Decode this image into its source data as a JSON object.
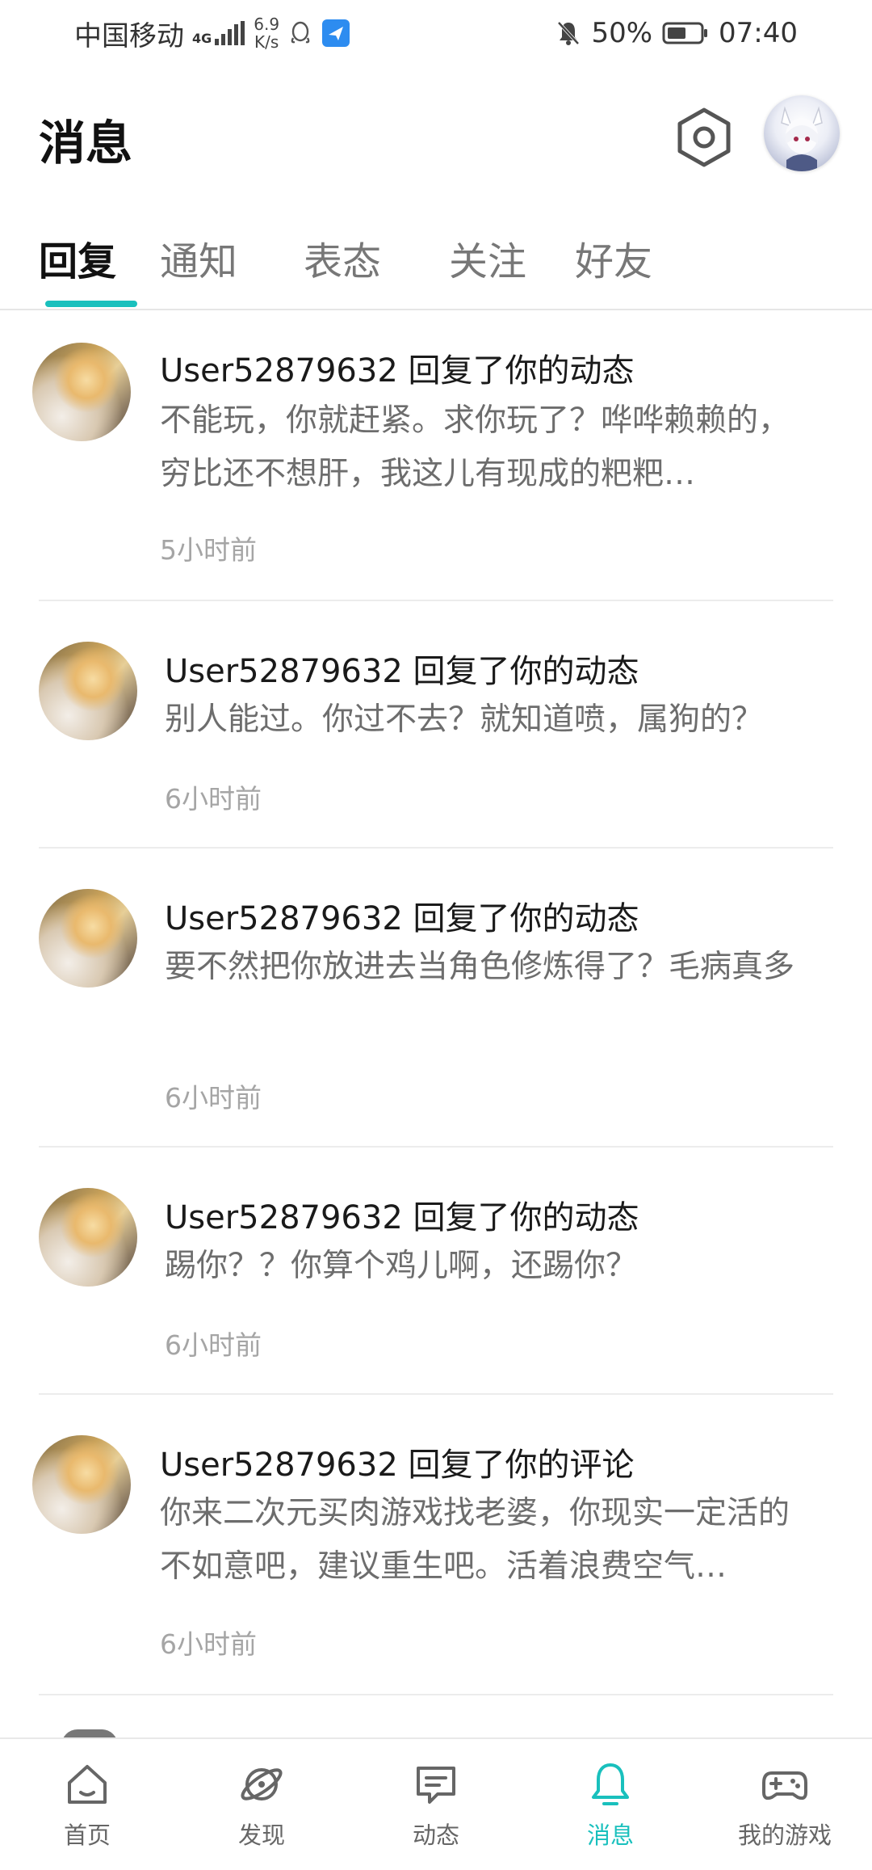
{
  "status_bar": {
    "carrier": "中国移动",
    "network_tag": "4G",
    "net_speed_value": "6.9",
    "net_speed_unit": "K/s",
    "battery": "50%",
    "time": "07:40"
  },
  "header": {
    "title": "消息"
  },
  "tabs": [
    {
      "label": "回复",
      "active": true
    },
    {
      "label": "通知",
      "active": false
    },
    {
      "label": "表态",
      "active": false
    },
    {
      "label": "关注",
      "active": false
    },
    {
      "label": "好友",
      "active": false
    }
  ],
  "messages": [
    {
      "title": "User52879632 回复了你的动态",
      "body": "不能玩，你就赶紧。求你玩了？哗哗赖赖的，穷比还不想肝，我这儿有现成的粑粑…",
      "time": "5小时前"
    },
    {
      "title": "User52879632 回复了你的动态",
      "body": "别人能过。你过不去？就知道喷，属狗的？",
      "time": "6小时前"
    },
    {
      "title": "User52879632 回复了你的动态",
      "body": "要不然把你放进去当角色修炼得了？毛病真多",
      "time": "6小时前"
    },
    {
      "title": "User52879632 回复了你的动态",
      "body": "踢你？？你算个鸡儿啊，还踢你？",
      "time": "6小时前"
    },
    {
      "title": "User52879632 回复了你的评论",
      "body": "你来二次元买肉游戏找老婆，你现实一定活的不如意吧，建议重生吧。活着浪费空气…",
      "time": "6小时前"
    }
  ],
  "bottom_nav": [
    {
      "label": "首页",
      "icon": "home-icon"
    },
    {
      "label": "发现",
      "icon": "planet-icon"
    },
    {
      "label": "动态",
      "icon": "chat-icon"
    },
    {
      "label": "消息",
      "icon": "bell-icon",
      "active": true
    },
    {
      "label": "我的游戏",
      "icon": "gamepad-icon"
    }
  ],
  "colors": {
    "accent": "#19c0bd",
    "text_primary": "#1a1a1a",
    "text_secondary": "#6d6d6d",
    "text_muted": "#a5a5a5"
  }
}
